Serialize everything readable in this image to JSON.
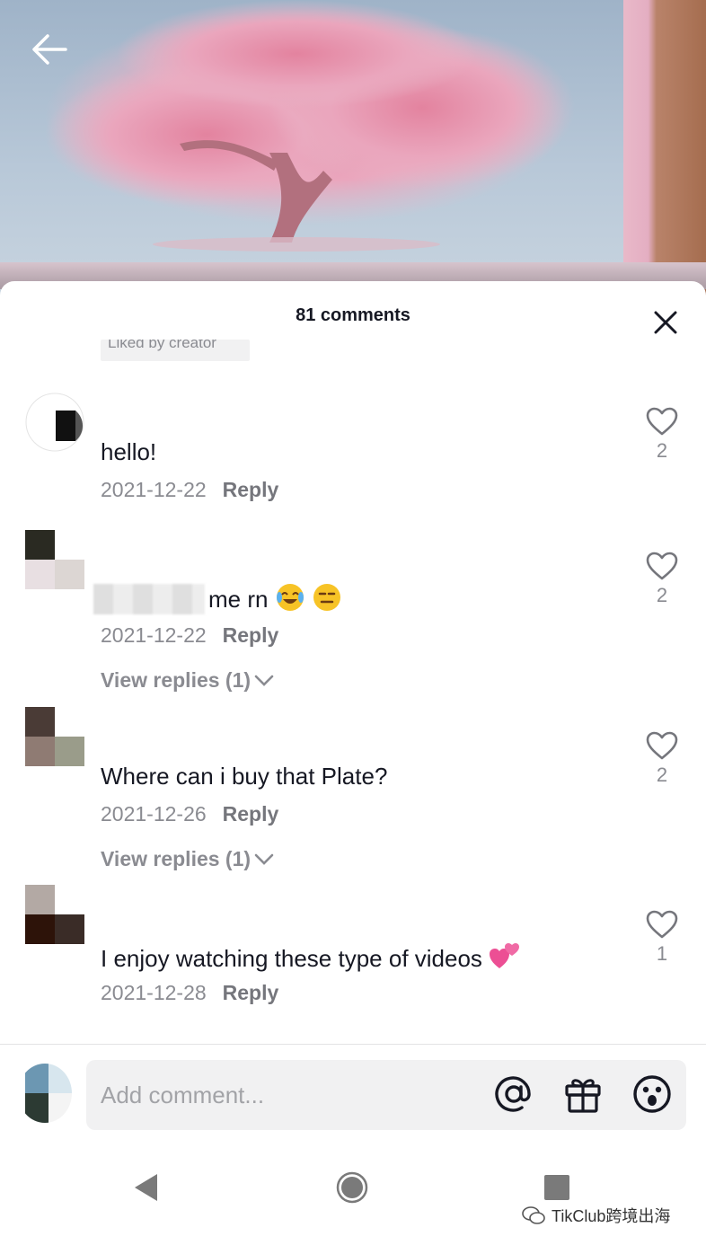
{
  "header": {
    "title": "81 comments"
  },
  "liked_chip": {
    "label": "Liked by creator"
  },
  "comments": [
    {
      "text": "hello!",
      "date": "2021-12-22",
      "reply_label": "Reply",
      "likes": "2"
    },
    {
      "text": "me rn",
      "date": "2021-12-22",
      "reply_label": "Reply",
      "likes": "2",
      "view_replies": "View replies (1)"
    },
    {
      "text": "Where can i buy that Plate?",
      "date": "2021-12-26",
      "reply_label": "Reply",
      "likes": "2",
      "view_replies": "View replies (1)"
    },
    {
      "text": "I enjoy watching these type of videos",
      "date": "2021-12-28",
      "reply_label": "Reply",
      "likes": "1"
    }
  ],
  "input": {
    "placeholder": "Add comment..."
  },
  "watermark": {
    "text": "TikClub跨境出海"
  },
  "colors": {
    "text_primary": "#161823",
    "text_secondary": "#8a8b91",
    "input_bg": "#f1f1f2",
    "tree_pink": "#e49ab4"
  }
}
